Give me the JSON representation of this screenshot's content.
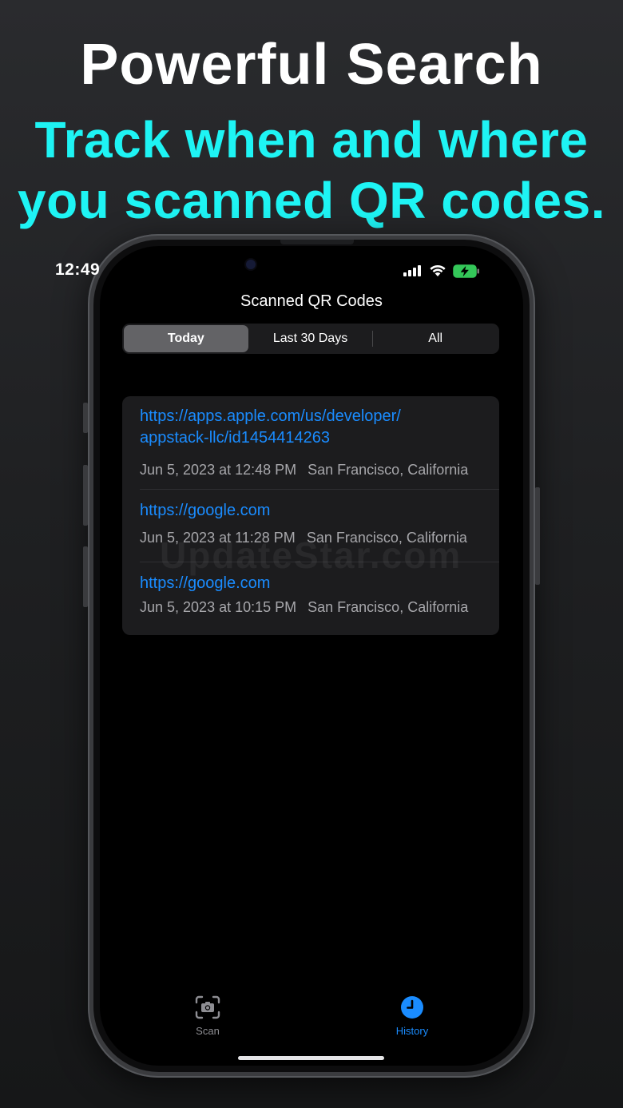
{
  "headline": "Powerful Search",
  "subline": {
    "line1": "Track when and where",
    "line2": "you scanned QR codes."
  },
  "status_bar": {
    "time": "12:49",
    "icons": [
      "cellular-signal-icon",
      "wifi-icon",
      "battery-charging-icon"
    ]
  },
  "nav": {
    "title": "Scanned QR Codes"
  },
  "segments": [
    {
      "label": "Today",
      "selected": true
    },
    {
      "label": "Last 30 Days",
      "selected": false
    },
    {
      "label": "All",
      "selected": false
    }
  ],
  "history": [
    {
      "url": "https://apps.apple.com/us/developer/appstack-llc/id1454414263",
      "url_line1": "https://apps.apple.com/us/developer/",
      "url_line2": "appstack-llc/id1454414263",
      "date": "Jun 5, 2023 at 12:48 PM",
      "location": "San Francisco, California"
    },
    {
      "url": "https://google.com",
      "date": "Jun 5, 2023 at 11:28 PM",
      "location": "San Francisco, California"
    },
    {
      "url": "https://google.com",
      "date": "Jun 5, 2023 at 10:15 PM",
      "location": "San Francisco, California"
    }
  ],
  "watermark": "UpdateStar.com",
  "tab_bar": [
    {
      "label": "Scan",
      "icon": "camera-viewfinder-icon",
      "selected": false
    },
    {
      "label": "History",
      "icon": "clock-icon",
      "selected": true
    }
  ],
  "colors": {
    "accent": "#1ef4f4",
    "link": "#1a8cff",
    "tab_selected": "#1a8cff",
    "tab_unselected": "#8e8e93"
  }
}
